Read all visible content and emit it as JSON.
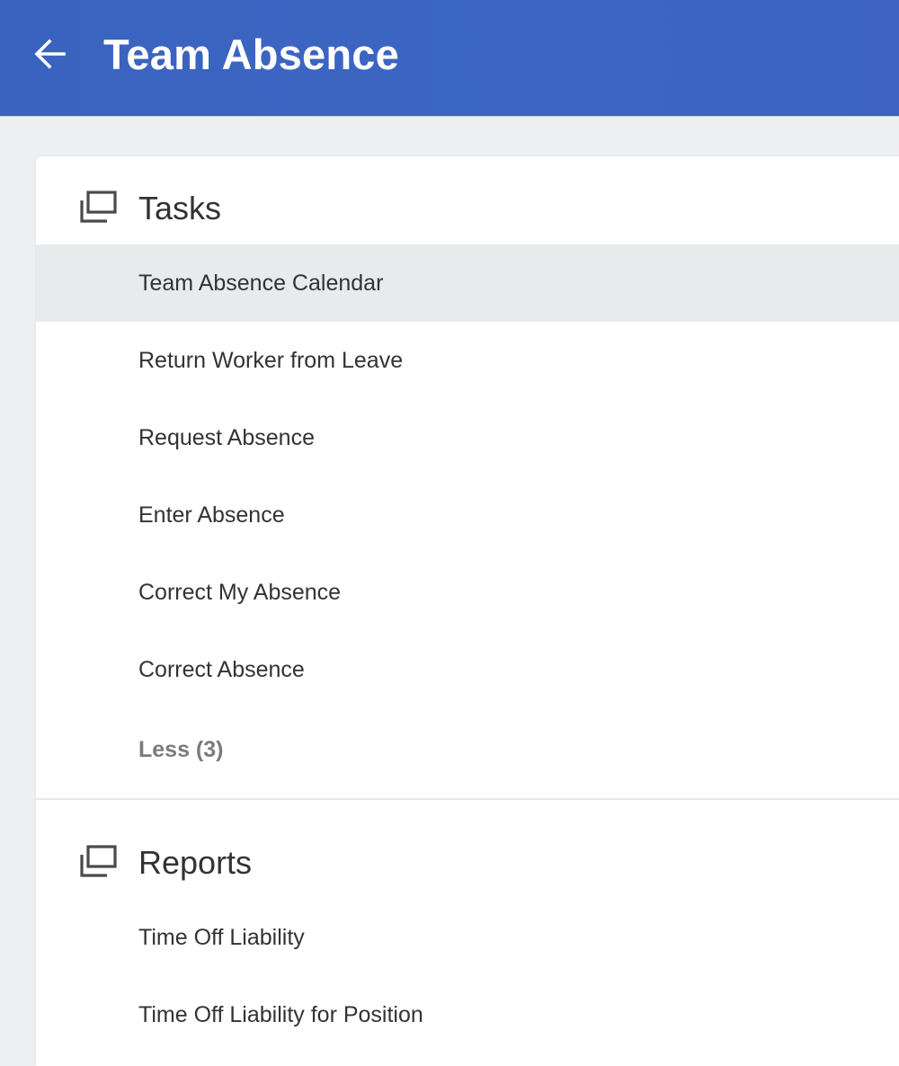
{
  "header": {
    "title": "Team Absence",
    "back_icon": "arrow-left-icon"
  },
  "tasks": {
    "title": "Tasks",
    "icon": "stacked-windows-icon",
    "items": [
      {
        "label": "Team Absence Calendar",
        "highlighted": true
      },
      {
        "label": "Return Worker from Leave"
      },
      {
        "label": "Request Absence"
      },
      {
        "label": "Enter Absence"
      },
      {
        "label": "Correct My Absence"
      },
      {
        "label": "Correct Absence"
      }
    ],
    "less_label": "Less (3)"
  },
  "reports": {
    "title": "Reports",
    "icon": "stacked-windows-icon",
    "items": [
      {
        "label": "Time Off Liability"
      },
      {
        "label": "Time Off Liability for Position"
      }
    ]
  },
  "colors": {
    "header_bg": "#3b64c2",
    "highlight_bg": "#e8eaec",
    "page_bg": "#eeeff2",
    "text": "#333333",
    "muted": "#7b7b7b"
  }
}
